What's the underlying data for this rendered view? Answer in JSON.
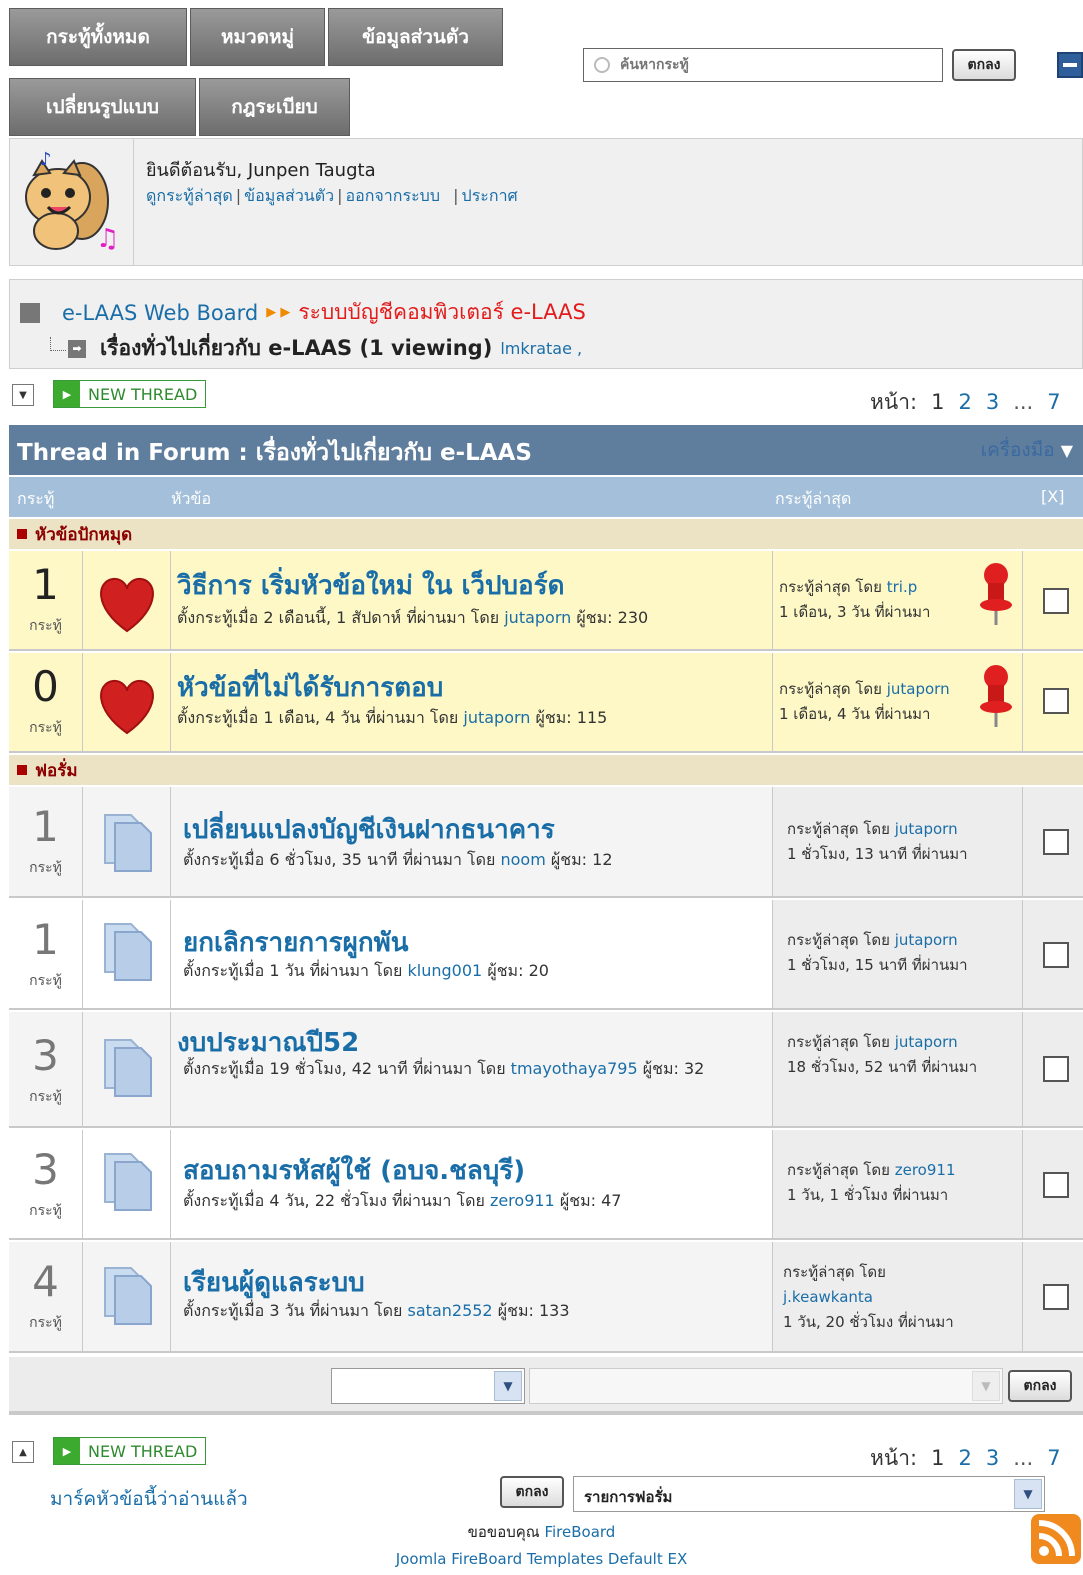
{
  "nav": {
    "tabs": [
      "กระทู้ทั้งหมด",
      "หมวดหมู่",
      "ข้อมูลส่วนตัว",
      "เปลี่ยนรูปแบบ",
      "กฎระเบียบ"
    ],
    "search_placeholder": "ค้นหากระทู้",
    "search_button": "ตกลง"
  },
  "user": {
    "welcome": "ยินดีต้อนรับ, Junpen Taugta",
    "links": [
      "ดูกระทู้ล่าสุด",
      "ข้อมูลส่วนตัว",
      "ออกจากระบบ",
      "ประกาศ"
    ]
  },
  "breadcrumb": {
    "root": "e-LAAS Web Board",
    "category": "ระบบบัญชีคอมพิวเตอร์ e-LAAS",
    "forum": "เรื่องทั่วไปเกี่ยวกับ e-LAAS (1 viewing)",
    "viewer": "lmkratae ,"
  },
  "toolbar": {
    "new_thread": "NEW THREAD",
    "page_label": "หน้า:",
    "pages": [
      "1",
      "2",
      "3",
      "...",
      "7"
    ]
  },
  "table": {
    "title": "Thread in Forum : เรื่องทั่วไปเกี่ยวกับ e-LAAS",
    "tools": "เครื่องมือ",
    "columns": [
      "กระทู้",
      "หัวข้อ",
      "กระทู้ล่าสุด",
      "[X]"
    ],
    "sticky_label": "หัวข้อปักหมุด",
    "forum_label": "ฟอรั่ม",
    "count_unit": "กระทู้",
    "last_prefix": "กระทู้ล่าสุด โดย",
    "sticky": [
      {
        "count": "1",
        "title": "วิธีการ เริ่มหัวข้อใหม่ ใน เว็ปบอร์ด",
        "meta_before": "ตั้งกระทู้เมื่อ 2 เดือนนี้, 1 สัปดาห์ ที่ผ่านมา โดย",
        "author": "jutaporn",
        "views": "ผู้ชม: 230",
        "last_user": "tri.p",
        "last_time": "1 เดือน, 3 วัน ที่ผ่านมา"
      },
      {
        "count": "0",
        "title": "หัวข้อที่ไม่ได้รับการตอบ",
        "meta_before": "ตั้งกระทู้เมื่อ 1 เดือน, 4 วัน ที่ผ่านมา โดย",
        "author": "jutaporn",
        "views": "ผู้ชม: 115",
        "last_user": "jutaporn",
        "last_time": "1 เดือน, 4 วัน ที่ผ่านมา"
      }
    ],
    "threads": [
      {
        "count": "1",
        "title": "เปลี่ยนแปลงบัญชีเงินฝากธนาคาร",
        "meta_before": "ตั้งกระทู้เมื่อ 6 ชั่วโมง, 35 นาที ที่ผ่านมา โดย",
        "author": "noom",
        "views": "ผู้ชม: 12",
        "last_user": "jutaporn",
        "last_time": "1 ชั่วโมง, 13 นาที ที่ผ่านมา"
      },
      {
        "count": "1",
        "title": "ยกเลิกรายการผูกพัน",
        "meta_before": "ตั้งกระทู้เมื่อ 1 วัน ที่ผ่านมา โดย",
        "author": "klung001",
        "views": "ผู้ชม: 20",
        "last_user": "jutaporn",
        "last_time": "1 ชั่วโมง, 15 นาที ที่ผ่านมา"
      },
      {
        "count": "3",
        "title": "งบประมาณปี52",
        "meta_before": "ตั้งกระทู้เมื่อ 19 ชั่วโมง, 42 นาที ที่ผ่านมา โดย",
        "author": "tmayothaya795",
        "views": "ผู้ชม: 32",
        "last_user": "jutaporn",
        "last_time": "18 ชั่วโมง, 52 นาที ที่ผ่านมา"
      },
      {
        "count": "3",
        "title": "สอบถามรหัสผู้ใช้ (อบจ.ชลบุรี)",
        "meta_before": "ตั้งกระทู้เมื่อ 4 วัน, 22 ชั่วโมง ที่ผ่านมา โดย",
        "author": "zero911",
        "views": "ผู้ชม: 47",
        "last_user": "zero911",
        "last_time": "1 วัน, 1 ชั่วโมง ที่ผ่านมา"
      },
      {
        "count": "4",
        "title": "เรียนผู้ดูแลระบบ",
        "meta_before": "ตั้งกระทู้เมื่อ 3 วัน ที่ผ่านมา โดย",
        "author": "satan2552",
        "views": "ผู้ชม: 133",
        "last_user": "j.keawkanta",
        "last_time": "1 วัน, 20 ชั่วโมง ที่ผ่านมา"
      }
    ],
    "bulk_button": "ตกลง"
  },
  "footer": {
    "mark_read": "มาร์คหัวข้อนี้ว่าอ่านแล้ว",
    "go_button": "ตกลง",
    "forum_select": "รายการฟอรั่ม",
    "thanks_prefix": "ขอขอบคุณ",
    "thanks_link": "FireBoard",
    "template_credit": "Joomla FireBoard Templates Default EX"
  },
  "colors": {
    "header_bar": "#5f7d9c",
    "column_bar": "#a4bfd9",
    "sticky_row": "#fdf8c6",
    "link": "#1a6ea8",
    "accent_red": "#e31b1b"
  }
}
